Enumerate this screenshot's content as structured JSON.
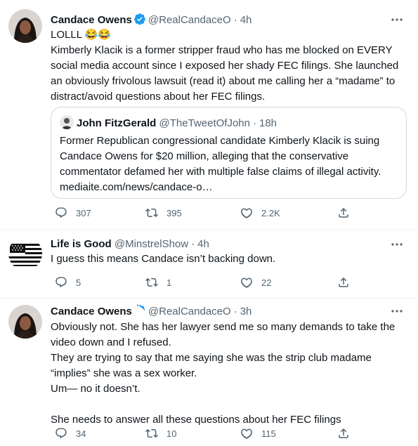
{
  "tweets": [
    {
      "name": "Candace Owens",
      "handle": "@RealCandaceO",
      "time": "4h",
      "lines": [
        "LOLLL 😂😂",
        "Kimberly Klacik is a former stripper fraud who has me blocked on EVERY",
        "social media account since I exposed her shady FEC filings. She launched",
        "an obviously frivolous lawsuit (read it) about me calling her a “madame” to",
        "distract/avoid questions about her FEC filings."
      ],
      "quote": {
        "name": "John FitzGerald",
        "handle": "@TheTweetOfJohn",
        "time": "18h",
        "lines": [
          "Former Republican congressional candidate Kimberly Klacik is suing",
          "Candace Owens for $20 million, alleging that the conservative",
          "commentator defamed her with multiple false claims of illegal activity.",
          "mediaite.com/news/candace-o…"
        ]
      },
      "replies": "307",
      "retweets": "395",
      "likes": "2.2K"
    },
    {
      "name": "Life is Good",
      "handle": "@MinstrelShow",
      "time": "4h",
      "lines": [
        "I guess this means Candace isn’t backing down."
      ],
      "replies": "5",
      "retweets": "1",
      "likes": "22"
    },
    {
      "name": "Candace Owens",
      "handle": "@RealCandaceO",
      "time": "3h",
      "lines": [
        "Obviously not. She has her lawyer send me so many demands to take the",
        "video down and I refused.",
        "They are trying to say that me saying she was the strip club madame",
        "“implies” she was a sex worker.",
        "Um— no it doesn’t.",
        "",
        "She needs to answer all these questions about her FEC filings"
      ],
      "replies": "34",
      "retweets": "10",
      "likes": "115"
    }
  ],
  "separator": "·",
  "colors": {
    "verified": "#1d9bf0",
    "meta": "#536471",
    "border": "#cfd9de"
  },
  "icons": [
    "verified-badge-icon",
    "more-icon",
    "reply-icon",
    "retweet-icon",
    "like-icon",
    "share-icon"
  ]
}
